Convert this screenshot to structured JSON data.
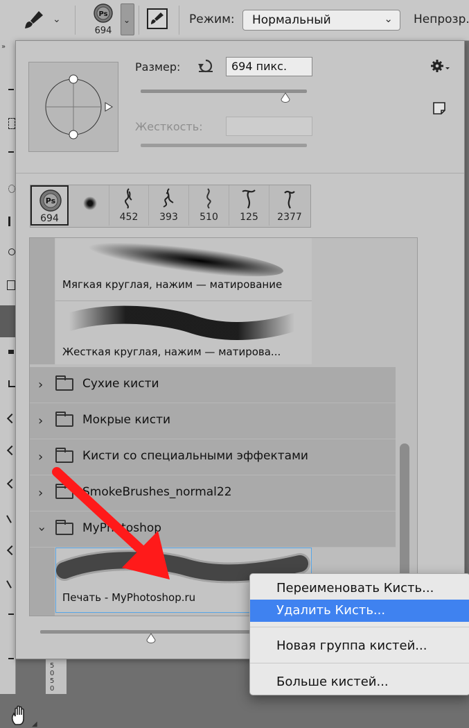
{
  "options_bar": {
    "brush_size_badge": "694",
    "mode_label": "Режим:",
    "mode_value": "Нормальный",
    "opacity_label": "Непрозр."
  },
  "brush_panel": {
    "size_label": "Размер:",
    "size_value": "694 пикс.",
    "hardness_label": "Жесткость:",
    "size_slider_fraction": 0.87,
    "bottom_slider_fraction": 0.4,
    "recent_brushes": [
      "694",
      "",
      "452",
      "393",
      "510",
      "125",
      "2377"
    ],
    "presets": [
      {
        "name": "Мягкая круглая, нажим — матирование"
      },
      {
        "name": "Жесткая круглая, нажим — матирова..."
      }
    ],
    "groups": [
      {
        "name": "Сухие кисти",
        "expanded": false
      },
      {
        "name": "Мокрые кисти",
        "expanded": false
      },
      {
        "name": "Кисти со специальными эффектами",
        "expanded": false
      },
      {
        "name": "SmokeBrushes_normal22",
        "expanded": false
      },
      {
        "name": "MyPhotoshop",
        "expanded": true
      }
    ],
    "selected_brush": "Печать - MyPhotoshop.ru"
  },
  "context_menu": {
    "rename": "Переименовать Кисть...",
    "delete": "Удалить Кисть...",
    "new_group": "Новая группа кистей...",
    "more": "Больше кистей..."
  },
  "colors": {
    "accent": "#3f82f0",
    "arrow": "#ff1a1a"
  }
}
